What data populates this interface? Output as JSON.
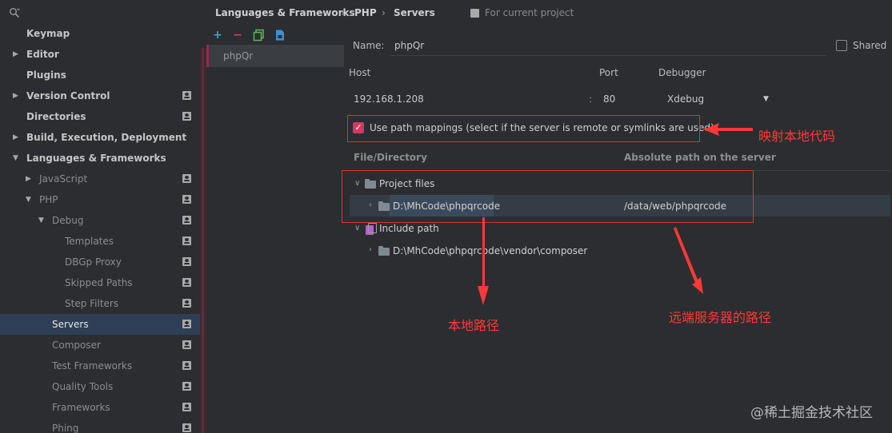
{
  "breadcrumb": {
    "items": [
      "Languages & Frameworks",
      "PHP",
      "Servers"
    ],
    "separator": "›",
    "scope_label": "For current project"
  },
  "sidebar": {
    "search_icon": "search-icon",
    "items": [
      {
        "label": "Keymap"
      },
      {
        "label": "Editor"
      },
      {
        "label": "Plugins"
      },
      {
        "label": "Version Control"
      },
      {
        "label": "Directories"
      },
      {
        "label": "Build, Execution, Deployment"
      },
      {
        "label": "Languages & Frameworks"
      },
      {
        "label": "JavaScript"
      },
      {
        "label": "PHP"
      },
      {
        "label": "Debug"
      },
      {
        "label": "Templates"
      },
      {
        "label": "DBGp Proxy"
      },
      {
        "label": "Skipped Paths"
      },
      {
        "label": "Step Filters"
      },
      {
        "label": "Servers"
      },
      {
        "label": "Composer"
      },
      {
        "label": "Test Frameworks"
      },
      {
        "label": "Quality Tools"
      },
      {
        "label": "Frameworks"
      },
      {
        "label": "Phing"
      }
    ]
  },
  "servers_list": {
    "toolbar": {
      "add": "+",
      "remove": "−"
    },
    "items": [
      "phpQr"
    ]
  },
  "server_form": {
    "name_label": "Name:",
    "name_value": "phpQr",
    "shared_label": "Shared",
    "host_label": "Host",
    "port_label": "Port",
    "debugger_label": "Debugger",
    "host_value": "192.168.1.208",
    "port_sep": ":",
    "port_value": "80",
    "debugger_value": "Xdebug",
    "use_path_mappings_label": "Use path mappings (select if the server is remote or symlinks are used)",
    "use_path_mappings_checked": true
  },
  "mappings": {
    "col_file": "File/Directory",
    "col_abs": "Absolute path on the server",
    "project_files_label": "Project files",
    "local_path": "D:\\MhCode\\phpqrcode",
    "server_path": "/data/web/phpqrcode",
    "include_path_label": "Include path",
    "include_local": "D:\\MhCode\\phpqrcode\\vendor\\composer"
  },
  "annotations": {
    "map_local": "映射本地代码",
    "local_path": "本地路径",
    "remote_path": "远端服务器的路径",
    "color": "#ff3838"
  },
  "watermark": "@稀土掘金技术社区"
}
